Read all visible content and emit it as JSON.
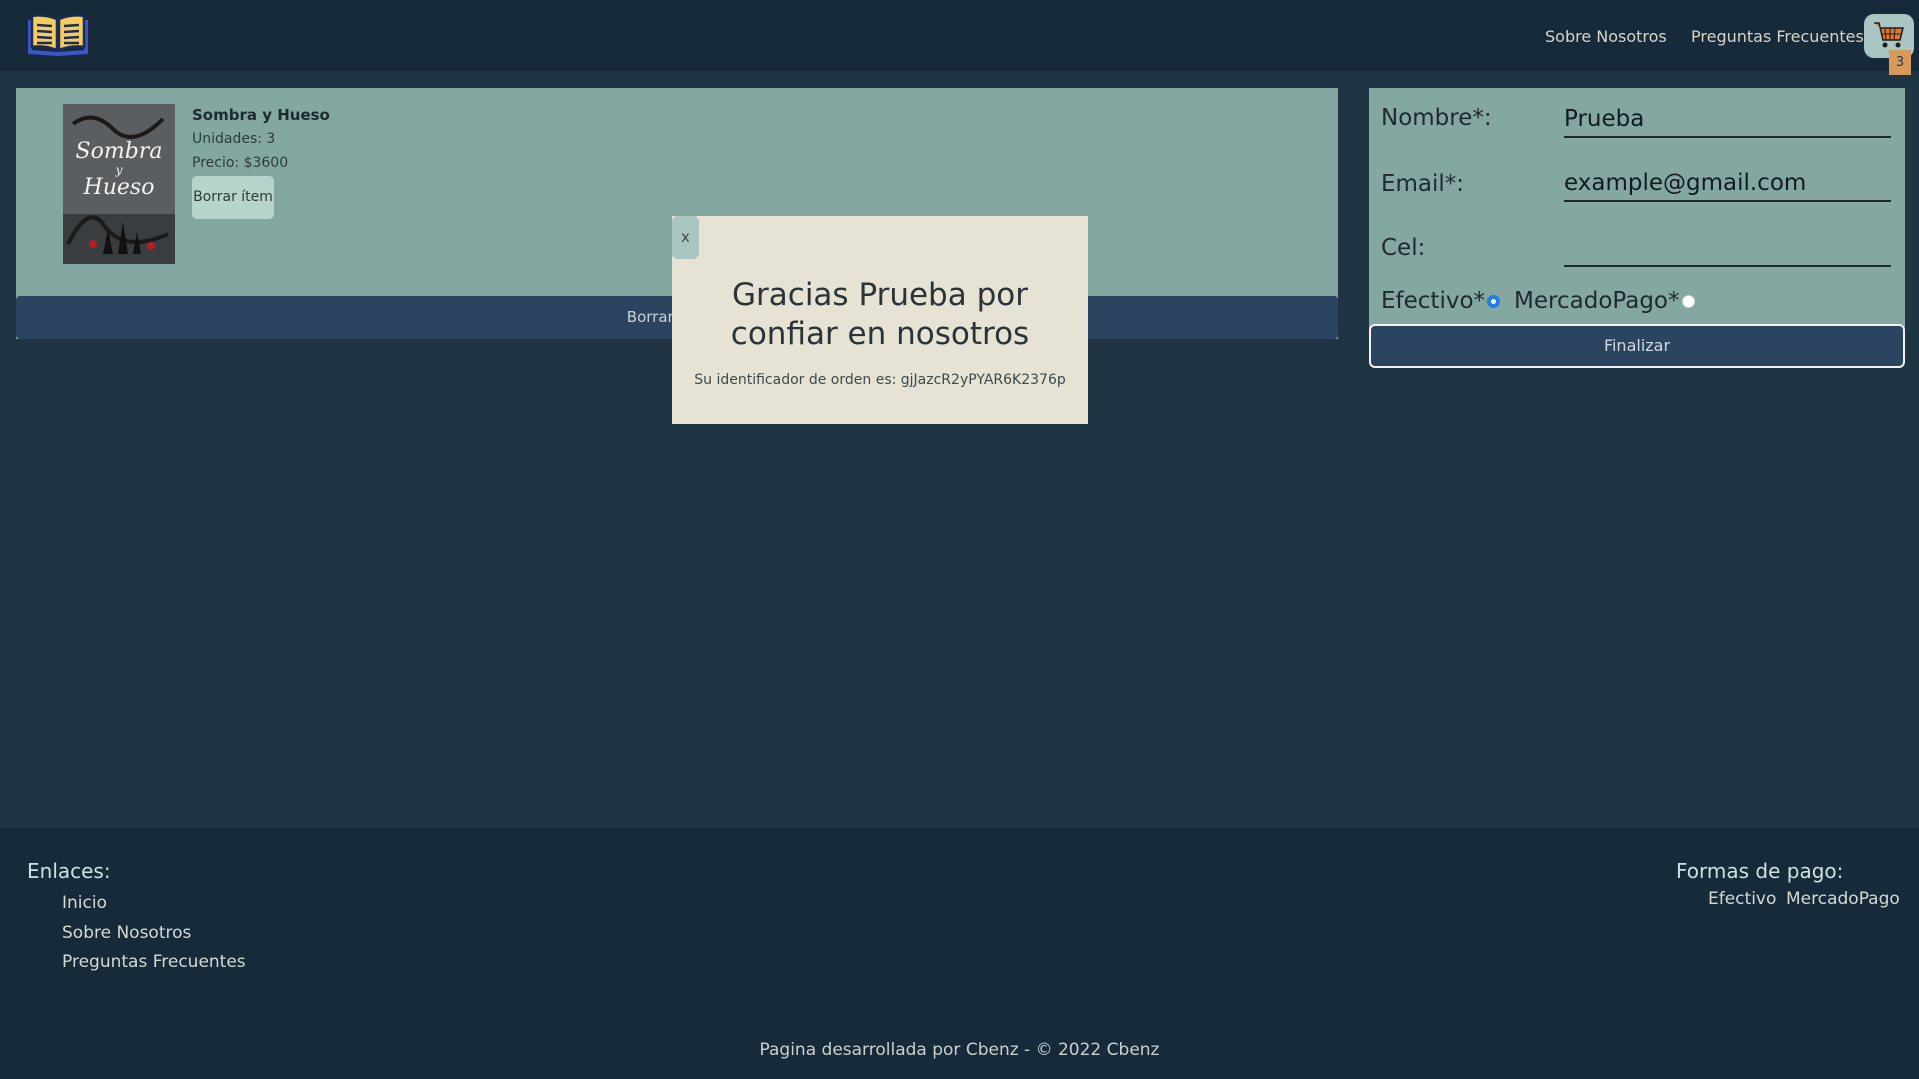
{
  "nav": {
    "about": "Sobre Nosotros",
    "faq": "Preguntas Frecuentes",
    "cart_count": "3"
  },
  "cart": {
    "items": [
      {
        "title": "Sombra y Hueso",
        "units": "Unidades: 3",
        "price": "Precio: $3600",
        "delete_label": "Borrar ítem",
        "cover_lines": [
          "Sombra",
          "y",
          "Hueso"
        ]
      }
    ],
    "clear_label": "Borrar carrito"
  },
  "form": {
    "name_label": "Nombre*:",
    "name_value": "Prueba",
    "email_label": "Email*:",
    "email_value": "example@gmail.com",
    "phone_label": "Cel:",
    "phone_value": "",
    "cash_label": "Efectivo*",
    "mp_label": "MercadoPago*",
    "payment_selected": "Efectivo",
    "submit_label": "Finalizar"
  },
  "modal": {
    "close_label": "x",
    "title": "Gracias Prueba por confiar en nosotros",
    "order_text": "Su identificador de orden es: gjJazcR2yPYAR6K2376p"
  },
  "footer": {
    "links_heading": "Enlaces:",
    "links": [
      "Inicio",
      "Sobre Nosotros",
      "Preguntas Frecuentes"
    ],
    "payments_heading": "Formas de pago:",
    "payments": [
      "Efectivo",
      "MercadoPago"
    ],
    "copyright": "Pagina desarrollada por Cbenz - © 2022 Cbenz"
  },
  "colors": {
    "navbar": "#172a3a",
    "background": "#1f3544",
    "panel": "#84a8a1",
    "button_dark": "#2b4560",
    "modal": "#e6e3d5",
    "badge": "#d89a5a",
    "radio_selected": "#1f7ce4"
  },
  "icons": [
    "book-logo-icon",
    "shopping-cart-icon"
  ]
}
